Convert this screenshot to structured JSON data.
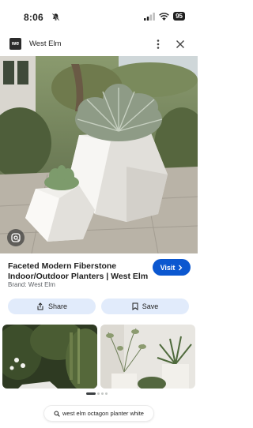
{
  "status": {
    "time": "8:06",
    "battery": "95"
  },
  "header": {
    "site_name": "West Elm",
    "logo_text": "we"
  },
  "result": {
    "title": "Faceted Modern Fiberstone Indoor/Outdoor Planters | West Elm",
    "brand": "Brand: West Elm",
    "visit_label": "Visit",
    "share_label": "Share",
    "save_label": "Save"
  },
  "carousel": {
    "pages": 4,
    "active": 0
  },
  "search": {
    "query": "west elm octagon planter white"
  },
  "icons": [
    "bell-slash-icon",
    "signal-icon",
    "wifi-icon",
    "more-icon",
    "close-icon",
    "lens-icon",
    "chevron-right-icon",
    "share-icon",
    "bookmark-icon",
    "search-icon"
  ],
  "colors": {
    "accent": "#0b57d0",
    "button_bg": "#e1ebfb"
  }
}
